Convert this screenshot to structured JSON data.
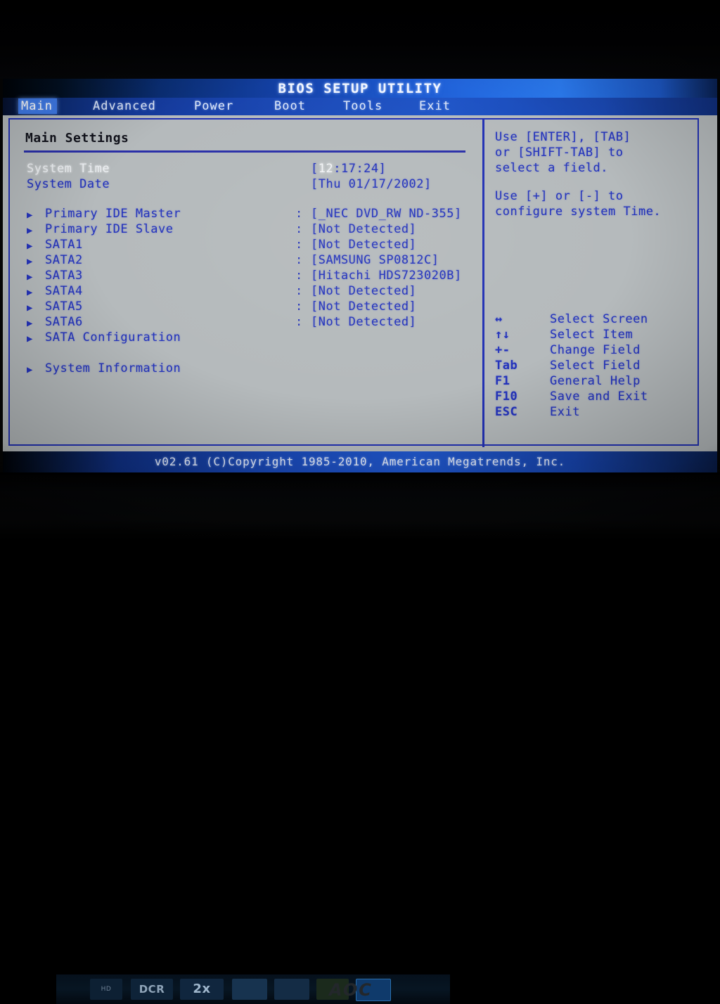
{
  "window": {
    "title": "BIOS SETUP UTILITY"
  },
  "menubar": {
    "items": [
      {
        "label": "Main",
        "selected": true
      },
      {
        "label": "Advanced",
        "selected": false
      },
      {
        "label": "Power",
        "selected": false
      },
      {
        "label": "Boot",
        "selected": false
      },
      {
        "label": "Tools",
        "selected": false
      },
      {
        "label": "Exit",
        "selected": false
      }
    ]
  },
  "main": {
    "section_title": "Main Settings",
    "fields": [
      {
        "label": "System Time",
        "value": "[12:17:24]",
        "highlighted": true,
        "cursor": "12"
      },
      {
        "label": "System Date",
        "value": "[Thu 01/17/2002]",
        "highlighted": false,
        "cursor": ""
      }
    ],
    "devices": [
      {
        "label": "Primary IDE Master",
        "value": "[_NEC DVD_RW ND-355]"
      },
      {
        "label": "Primary IDE Slave",
        "value": "[Not Detected]"
      },
      {
        "label": "SATA1",
        "value": "[Not Detected]"
      },
      {
        "label": "SATA2",
        "value": "[SAMSUNG SP0812C]"
      },
      {
        "label": "SATA3",
        "value": "[Hitachi HDS723020B]"
      },
      {
        "label": "SATA4",
        "value": "[Not Detected]"
      },
      {
        "label": "SATA5",
        "value": "[Not Detected]"
      },
      {
        "label": "SATA6",
        "value": "[Not Detected]"
      },
      {
        "label": "SATA Configuration",
        "value": ""
      }
    ],
    "submenus": [
      {
        "label": "System Information"
      }
    ],
    "colon": ":"
  },
  "help": {
    "paragraph1": "Use [ENTER], [TAB]\nor [SHIFT-TAB] to\nselect a field.",
    "paragraph2": "Use [+] or [-] to\nconfigure system Time."
  },
  "legend": {
    "entries": [
      {
        "key": "↔",
        "desc": "Select Screen"
      },
      {
        "key": "↑↓",
        "desc": "Select Item"
      },
      {
        "key": "+-",
        "desc": "Change Field"
      },
      {
        "key": "Tab",
        "desc": "Select Field"
      },
      {
        "key": "F1",
        "desc": "General Help"
      },
      {
        "key": "F10",
        "desc": "Save and Exit"
      },
      {
        "key": "ESC",
        "desc": "Exit"
      }
    ]
  },
  "footer": {
    "copyright": "v02.61 (C)Copyright 1985-2010, American Megatrends, Inc."
  },
  "monitor": {
    "brand": "AOC",
    "stickers": [
      "HD",
      "DCR",
      "2x",
      "",
      "",
      "",
      ""
    ]
  },
  "colors": {
    "accent_blue": "#2433bb",
    "title_blue": "#1f55c8",
    "panel_bg": "#b6bbbd",
    "highlight": "#3f7ae8",
    "text_light": "#eef1f4"
  }
}
